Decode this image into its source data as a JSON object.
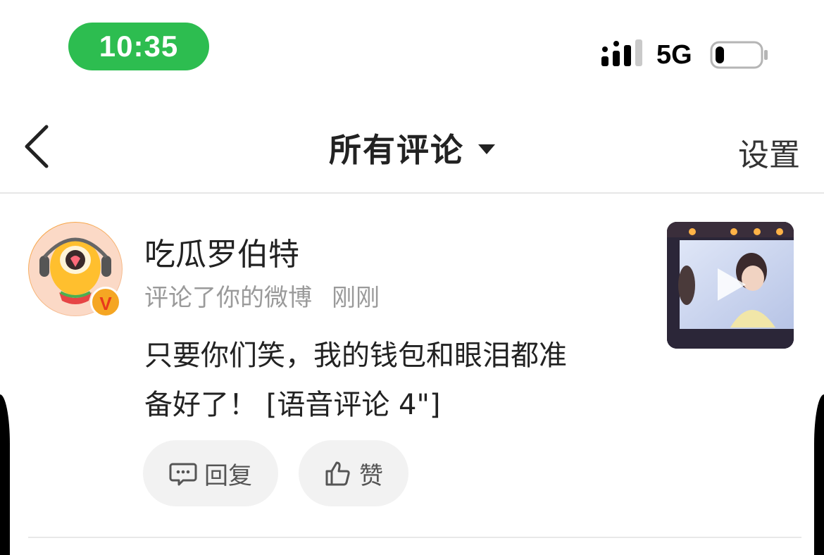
{
  "status_bar": {
    "time": "10:35",
    "network": "5G",
    "time_pill_color": "#2dbd50",
    "signal_bars_filled": 4,
    "battery_level": 0.1
  },
  "nav": {
    "title": "所有评论",
    "settings_label": "设置",
    "back_icon": "chevron-left-icon",
    "dropdown_icon": "caret-down-icon"
  },
  "comment": {
    "username": "吃瓜罗伯特",
    "verified_badge": "V",
    "action": "评论了你的微博",
    "time_ago": "刚刚",
    "text_line1": "只要你们笑，我的钱包和眼泪都准",
    "text_line2": "备好了！ [语音评论 4\"]",
    "reply_label": "回复",
    "like_label": "赞",
    "thumbnail_type": "video",
    "badge_color": "#f5a623"
  }
}
